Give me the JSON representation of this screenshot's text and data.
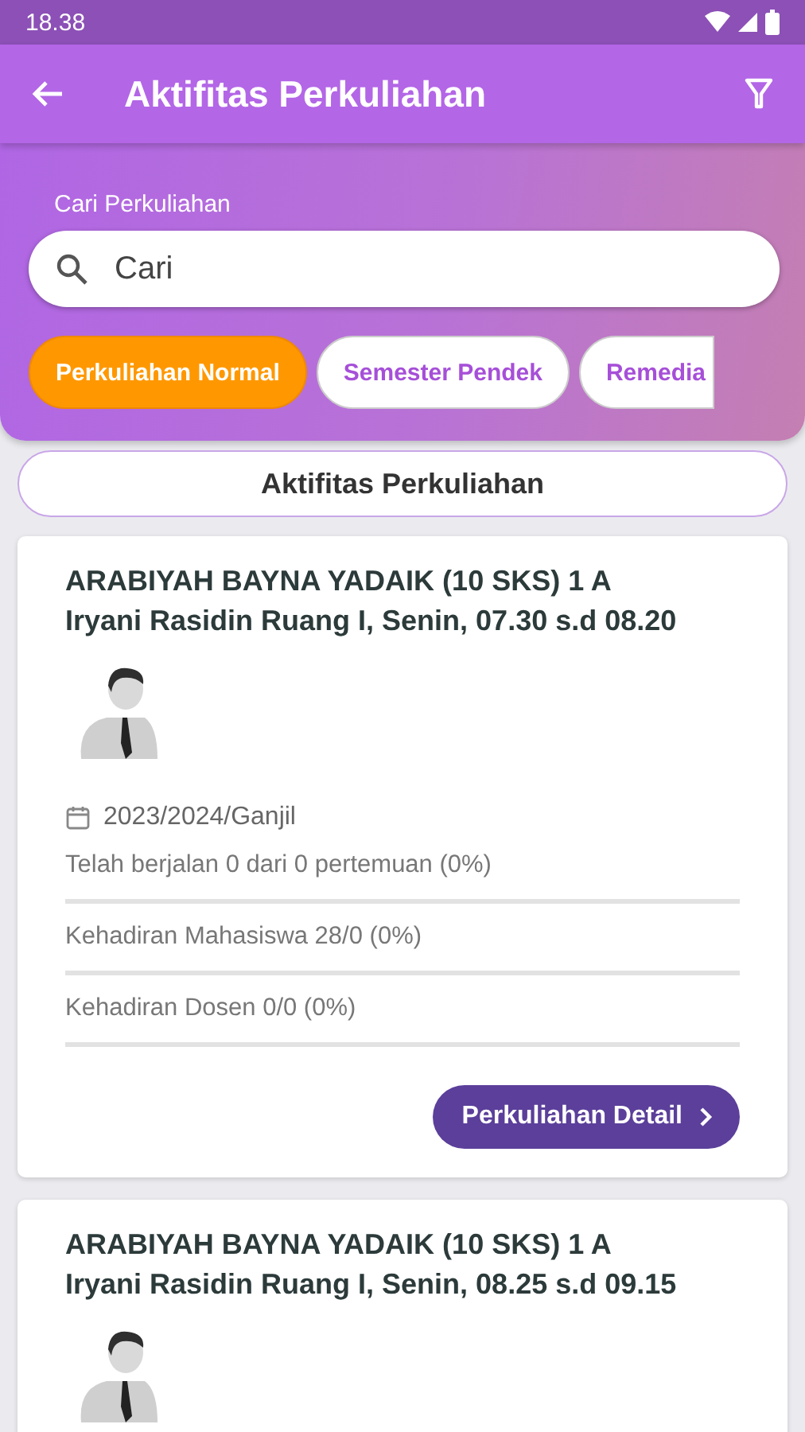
{
  "status_bar": {
    "time": "18.38"
  },
  "app_bar": {
    "title": "Aktifitas Perkuliahan"
  },
  "search": {
    "label": "Cari Perkuliahan",
    "placeholder": "Cari"
  },
  "filters": [
    {
      "label": "Perkuliahan Normal",
      "selected": true
    },
    {
      "label": "Semester Pendek",
      "selected": false
    },
    {
      "label": "Remedia",
      "selected": false
    }
  ],
  "section_title": "Aktifitas Perkuliahan",
  "courses": [
    {
      "title": "ARABIYAH BAYNA YADAIK (10 SKS) 1 A",
      "schedule": "Iryani Rasidin Ruang I, Senin, 07.30 s.d 08.20",
      "period": "2023/2024/Ganjil",
      "stats": [
        "Telah berjalan 0 dari 0 pertemuan (0%)",
        "Kehadiran Mahasiswa 28/0 (0%)",
        "Kehadiran Dosen 0/0 (0%)"
      ],
      "button": "Perkuliahan Detail"
    },
    {
      "title": "ARABIYAH BAYNA YADAIK (10 SKS) 1 A",
      "schedule": "Iryani Rasidin Ruang I, Senin, 08.25 s.d 09.15"
    }
  ]
}
